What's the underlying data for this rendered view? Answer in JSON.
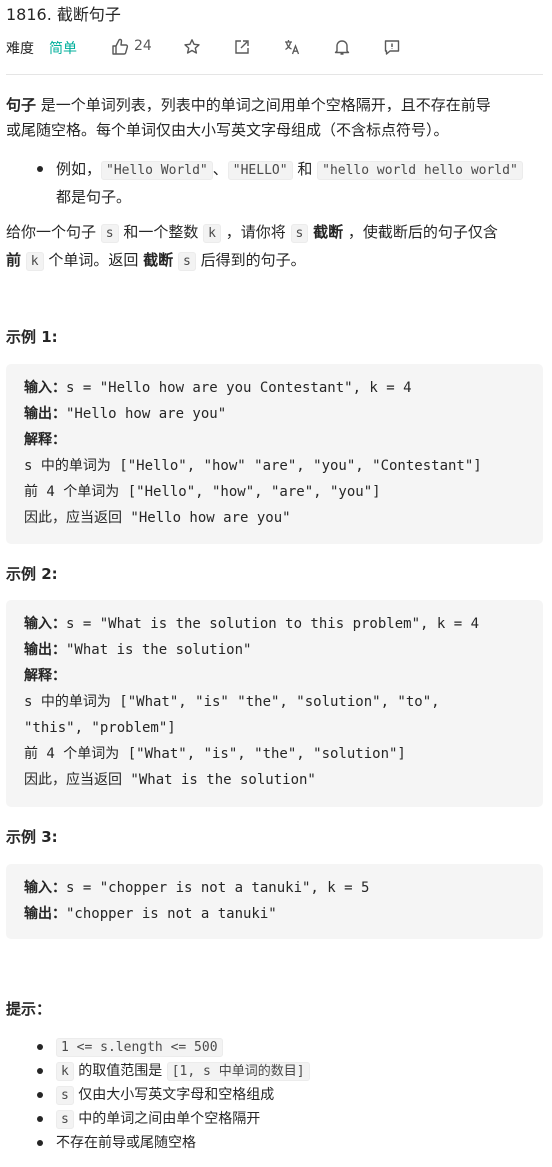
{
  "problem": {
    "title": "1816. 截断句子",
    "difficulty_label": "难度",
    "difficulty": "简单",
    "likes": "24"
  },
  "description": {
    "p1_bold": "句子",
    "p1_rest_line1": " 是一个单词列表，列表中的单词之间用单个空格隔开，且不存在前导",
    "p1_line2": "或尾随空格。每个单词仅由大小写英文字母组成（不含标点符号）。",
    "bullet_prefix": "例如，",
    "bullet_code1": "\"Hello World\"",
    "bullet_sep1": "、",
    "bullet_code2": "\"HELLO\"",
    "bullet_and": " 和 ",
    "bullet_code3": "\"hello world hello world\"",
    "bullet_line2": "都是句子。",
    "p2_a": "给你一个句子 ",
    "p2_s": "s",
    "p2_b": " 和一个整数 ",
    "p2_k": "k",
    "p2_c": " ，请你将 ",
    "p2_s2": "s",
    "p2_bold1": "截断",
    "p2_d": " ，使截断后的句子仅含",
    "p2_bold2": "前",
    "p2_k2": "k",
    "p2_e": " 个单词。返回 ",
    "p2_bold3": "截断",
    "p2_s3": "s",
    "p2_f": " 后得到的句子。"
  },
  "examples": [
    {
      "title": "示例 1:",
      "input_label": "输入：",
      "input": "s = \"Hello how are you Contestant\", k = 4",
      "output_label": "输出：",
      "output": "\"Hello how are you\"",
      "explain_label": "解释：",
      "explain_lines": [
        "s 中的单词为 [\"Hello\", \"how\" \"are\", \"you\", \"Contestant\"]",
        "前 4 个单词为 [\"Hello\", \"how\", \"are\", \"you\"]",
        "因此，应当返回 \"Hello how are you\""
      ]
    },
    {
      "title": "示例 2:",
      "input_label": "输入：",
      "input": "s = \"What is the solution to this problem\", k = 4",
      "output_label": "输出：",
      "output": "\"What is the solution\"",
      "explain_label": "解释：",
      "explain_lines": [
        "s 中的单词为 [\"What\", \"is\" \"the\", \"solution\", \"to\",",
        "\"this\", \"problem\"]",
        "前 4 个单词为 [\"What\", \"is\", \"the\", \"solution\"]",
        "因此，应当返回 \"What is the solution\""
      ]
    },
    {
      "title": "示例 3:",
      "input_label": "输入：",
      "input": "s = \"chopper is not a tanuki\", k = 5",
      "output_label": "输出：",
      "output": "\"chopper is not a tanuki\""
    }
  ],
  "hints": {
    "title": "提示：",
    "h1_code": "1 <= s.length <= 500",
    "h2_code": "k",
    "h2_text": " 的取值范围是 ",
    "h2_code2": "[1,  s 中单词的数目]",
    "h3_code": "s",
    "h3_text": " 仅由大小写英文字母和空格组成",
    "h4_code": "s",
    "h4_text": " 中的单词之间由单个空格隔开",
    "h5_text": "不存在前导或尾随空格"
  }
}
